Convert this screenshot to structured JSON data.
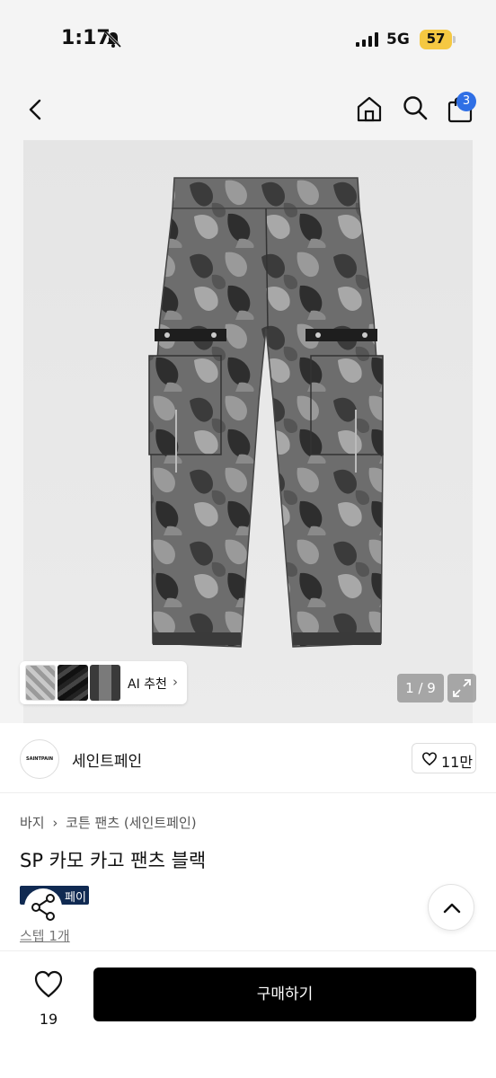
{
  "status_bar": {
    "time": "1:17",
    "network": "5G",
    "battery": "57",
    "battery_color": "#f5c842"
  },
  "nav": {
    "back_icon": "chevron-left-icon",
    "home_icon": "home-icon",
    "search_icon": "search-icon",
    "cart_icon": "shopping-bag-icon",
    "cart_count": "3",
    "badge_color": "#2f6fe5"
  },
  "gallery": {
    "ai_recommend_label": "AI 추천",
    "page_indicator": "1 / 9"
  },
  "brand": {
    "logo_text": "SAINTPAIN",
    "name": "세인트페인",
    "likes": "11만"
  },
  "product": {
    "breadcrumb": [
      "바지",
      "코튼 팬츠 (세인트페인)"
    ],
    "title": "SP 카모 카고 팬츠 블랙",
    "pay_badge": "페이",
    "shipping": "스텝 1개"
  },
  "bottom_bar": {
    "wish_count": "19",
    "buy_label": "구매하기"
  }
}
